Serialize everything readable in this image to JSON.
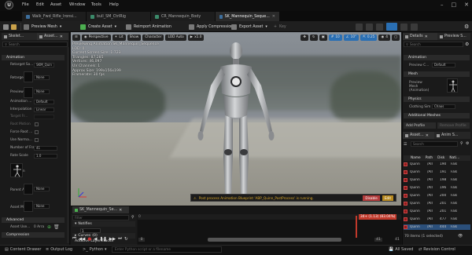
{
  "app": {
    "logo": "U",
    "menu": [
      "File",
      "Edit",
      "Asset",
      "Window",
      "Tools",
      "Help"
    ],
    "tabs": [
      {
        "label": "Walk_Fwd_Rifle_Ironsi...",
        "active": false
      },
      {
        "label": "bull_SM_CtrlRig",
        "active": false
      },
      {
        "label": "CR_Mannequin_Body",
        "active": false
      },
      {
        "label": "SK_Mannequin_Seque...",
        "active": true
      }
    ]
  },
  "toolbar": {
    "preview_mesh": "Preview Mesh",
    "create_asset": "Create Asset",
    "reimport_animation": "Reimport Animation",
    "apply_compression": "Apply Compression",
    "export_asset": "Export Asset",
    "key": "Key"
  },
  "left_panel": {
    "tab_skeleton": "Skelet...",
    "tab_asset": "Asset...",
    "search_placeholder": "Search",
    "section_animation": "Animation",
    "retarget_source": "Retarget So...",
    "retarget_source_value": "SKM_Quin",
    "retarget_source_asset": "Retarget S...",
    "retarget_source_asset_value": "None",
    "preview_pose": "Preview P...",
    "preview_pose_value": "None",
    "animation_track": "Animation ...",
    "animation_track_value": "Default",
    "interpolation": "Interpolation",
    "interpolation_value": "Linear",
    "target_frame_rate": "Target Fr...",
    "root_motion": "Root Motion",
    "force_root_lock": "Force Root ...",
    "use_normalized": "Use Norma...",
    "number_of_frames": "Number of Fra...",
    "number_of_frames_value": "41",
    "rate_scale": "Rate Scale",
    "rate_scale_value": "1.0",
    "skeleton": "Skeleton",
    "parent_asset": "Parent As...",
    "parent_asset_value": "None",
    "asset_mapping": "Asset Map...",
    "asset_mapping_value": "None",
    "section_advanced": "Advanced",
    "asset_user_data": "Asset Use...",
    "asset_user_data_value": "0 Arra",
    "section_compression": "Compression"
  },
  "viewport": {
    "perspective": "Perspective",
    "lit": "Lit",
    "show": "Show",
    "character": "Character",
    "lod_auto": "LOD Auto",
    "speed": "x1.0",
    "grid_snap": "10",
    "rot_snap": "10°",
    "scale_snap": "0.25",
    "cam_speed": "4",
    "stats": [
      "Previewing Animation SK_Mannequin_Sequence",
      "LOD: 0",
      "Current Screen Size: 1.723",
      "Triangles: 87,285",
      "Vertices: 46,097",
      "UV Channels: 1",
      "Approx Size: 199x156x199",
      "Framerate: 30 fps"
    ],
    "notification": "Post process Animation Blueprint 'ABP_Quinn_PostProcess' is running.",
    "notify_disable": "Disable",
    "notify_edit": "Edit"
  },
  "right_panel": {
    "tab_details": "Details",
    "tab_preview": "Preview S...",
    "search_placeholder": "Search",
    "section_animation": "Animation",
    "preview_controller": "Preview C...",
    "preview_controller_value": "Default",
    "section_mesh": "Mesh",
    "preview_mesh_label": "Preview Mesh (Animation)",
    "section_physics": "Physics",
    "clothing_sim": "Clothing Sim",
    "clothing_sim_value": "Chaos",
    "section_additional": "Additional Meshes",
    "add_profile": "Add Profile",
    "remove_profile": "Remove Profile",
    "asset_tab": "Asset...",
    "anim_tab": "Anim S...",
    "list_search": "Search",
    "columns": [
      "Name",
      "Path",
      "Disk",
      "Nati..."
    ],
    "rows": [
      {
        "name": "Quinn",
        "path": "/All",
        "disk": "190",
        "native": "Fals",
        "selected": false
      },
      {
        "name": "Quinn",
        "path": "/All",
        "disk": "191",
        "native": "Fals",
        "selected": false
      },
      {
        "name": "Quinn",
        "path": "/All",
        "disk": "198",
        "native": "Fals",
        "selected": false
      },
      {
        "name": "Quinn",
        "path": "/All",
        "disk": "196",
        "native": "Fals",
        "selected": false
      },
      {
        "name": "Quinn",
        "path": "/All",
        "disk": "200",
        "native": "Fals",
        "selected": false
      },
      {
        "name": "Quinn",
        "path": "/All",
        "disk": "201",
        "native": "Fals",
        "selected": false
      },
      {
        "name": "Quinn",
        "path": "/All",
        "disk": "201",
        "native": "Fals",
        "selected": false
      },
      {
        "name": "Quinn",
        "path": "/All",
        "disk": "477",
        "native": "Fals",
        "selected": false
      },
      {
        "name": "Quinn",
        "path": "/All",
        "disk": "444",
        "native": "Fals",
        "selected": true
      }
    ],
    "items_count": "70 items (1 selected)"
  },
  "timeline": {
    "tab": "SK_Mannequin_Se...",
    "filter_placeholder": "Filter",
    "frame_readout": "34+ (1.13) (83.04%)",
    "notifies": "Notifies",
    "notifies_count": "1",
    "curves": "Curves",
    "curves_count": "(0)",
    "additive_layer": "Additive Layer Tracks",
    "attributes": "Attributes",
    "start": "0",
    "start2": "0",
    "end": "41",
    "end2": "41"
  },
  "statusbar": {
    "content_drawer": "Content Drawer",
    "output_log": "Output Log",
    "python": "Python",
    "cmd_placeholder": "Enter Python script or a filename",
    "all_saved": "All Saved",
    "revision_control": "Revision Control"
  },
  "colors": {
    "accent_green": "#4caf50",
    "notification_amber": "#d9a72a",
    "selection_blue": "#2b4f7a",
    "playhead_red": "#c0392b"
  }
}
